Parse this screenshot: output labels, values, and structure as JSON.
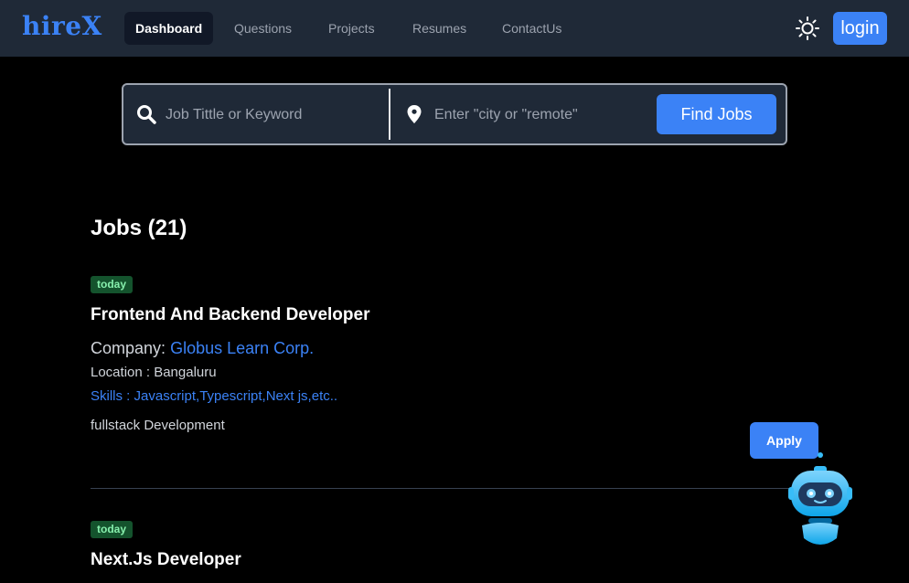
{
  "nav": {
    "logo": "hireX",
    "links": [
      {
        "label": "Dashboard",
        "active": true
      },
      {
        "label": "Questions",
        "active": false
      },
      {
        "label": "Projects",
        "active": false
      },
      {
        "label": "Resumes",
        "active": false
      },
      {
        "label": "ContactUs",
        "active": false
      }
    ],
    "theme_icon": "sun-icon",
    "login_label": "login"
  },
  "search": {
    "keyword_placeholder": "Job Tittle or Keyword",
    "location_placeholder": "Enter \"city or \"remote\"",
    "button_label": "Find Jobs",
    "icons": [
      "search-icon",
      "location-pin-icon"
    ]
  },
  "jobs": {
    "heading": "Jobs (21)",
    "items": [
      {
        "badge": "today",
        "title": "Frontend And Backend Developer",
        "company_label": "Company:",
        "company_name": "Globus Learn Corp.",
        "location": "Location : Bangaluru",
        "skills": "Skills : Javascript,Typescript,Next js,etc..",
        "description": "fullstack Development",
        "apply_label": "Apply"
      },
      {
        "badge": "today",
        "title": "Next.Js Developer"
      }
    ]
  },
  "colors": {
    "accent": "#3b82f6",
    "nav_bg": "#1f2937",
    "badge_bg": "#14532d",
    "badge_text": "#86efac"
  },
  "assistant_icon": "robot-assistant-icon"
}
